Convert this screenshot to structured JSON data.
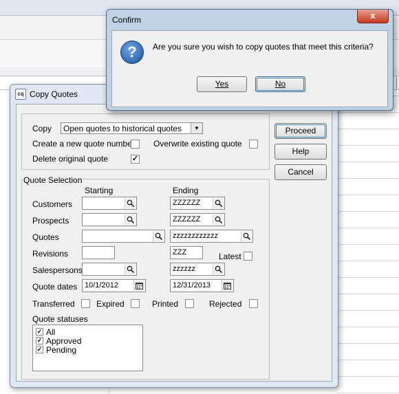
{
  "copy_quotes": {
    "title": "Copy Quotes",
    "icon_text": "cq",
    "copy_label": "Copy",
    "copy_value": "Open quotes to historical quotes",
    "create_new_label": "Create a new quote number",
    "create_new_checked": false,
    "overwrite_label": "Overwrite existing quote",
    "overwrite_checked": false,
    "delete_label": "Delete original quote",
    "delete_checked": true,
    "quote_selection": {
      "legend": "Quote Selection",
      "starting_header": "Starting",
      "ending_header": "Ending",
      "rows": {
        "customers": {
          "label": "Customers",
          "start": "",
          "end": "ZZZZZZ"
        },
        "prospects": {
          "label": "Prospects",
          "start": "",
          "end": "ZZZZZZ"
        },
        "quotes": {
          "label": "Quotes",
          "start": "",
          "end": "zzzzzzzzzzzz"
        },
        "revisions": {
          "label": "Revisions",
          "start": "",
          "end": "ZZZ"
        },
        "salespersons": {
          "label": "Salespersons",
          "start": "",
          "end": "zzzzzz"
        },
        "dates": {
          "label": "Quote dates",
          "start": "10/1/2012",
          "end": "12/31/2013"
        }
      },
      "latest_label": "Latest",
      "transferred_label": "Transferred",
      "expired_label": "Expired",
      "printed_label": "Printed",
      "rejected_label": "Rejected",
      "statuses_label": "Quote statuses",
      "statuses": [
        {
          "label": "All",
          "checked": true
        },
        {
          "label": "Approved",
          "checked": true
        },
        {
          "label": "Pending",
          "checked": true
        }
      ]
    },
    "buttons": {
      "proceed": "Proceed",
      "help": "Help",
      "cancel": "Cancel"
    }
  },
  "confirm": {
    "title": "Confirm",
    "close_glyph": "x",
    "icon_glyph": "?",
    "message": "Are you sure you wish to copy quotes that meet this criteria?",
    "yes": "Yes",
    "no": "No"
  },
  "colors": {
    "window_frame": "#dfe8f3",
    "dialog_frame": "#bfd2e8",
    "close_red": "#c43a22",
    "question_blue": "#1b4f9a"
  }
}
